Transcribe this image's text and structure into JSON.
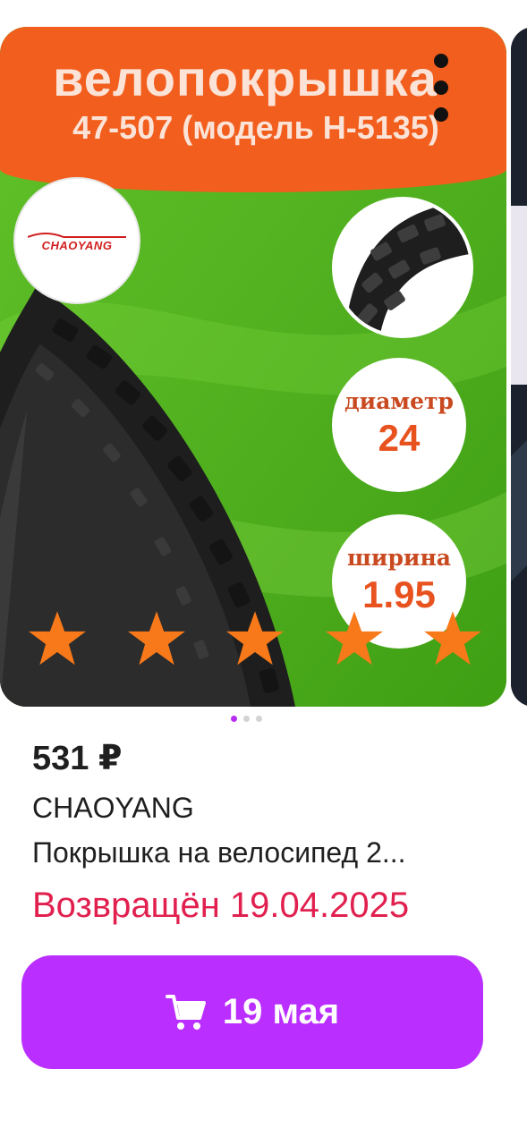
{
  "product_image": {
    "banner_title": "велопокрышка",
    "banner_subtitle": "47-507 (модель H-5135)",
    "brand_logo": "CHAOYANG",
    "spec_diameter_label": "диаметр",
    "spec_diameter_value": "24",
    "spec_width_label": "ширина",
    "spec_width_value": "1.95",
    "rating_stars": 5,
    "colors": {
      "banner": "#f25e1d",
      "background": "#4fb61f",
      "star": "#f7791a"
    }
  },
  "gallery": {
    "current_page": 1,
    "total_pages": 3
  },
  "product": {
    "price": "531 ₽",
    "brand": "CHAOYANG",
    "title": "Покрышка на велосипед 2...",
    "status": "Возвращён 19.04.2025"
  },
  "cart_button": {
    "icon": "cart-icon",
    "label": "19 мая",
    "color": "#ba2fff"
  }
}
